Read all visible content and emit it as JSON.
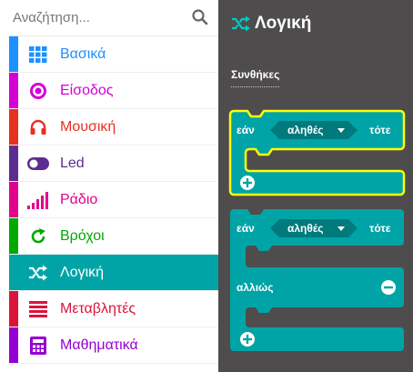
{
  "search": {
    "placeholder": "Αναζήτηση...",
    "icon": "search-icon"
  },
  "categories": [
    {
      "label": "Βασικά",
      "color": "#1e90ff",
      "icon": "grid-icon"
    },
    {
      "label": "Είσοδος",
      "color": "#d400d4",
      "icon": "input-circle-icon"
    },
    {
      "label": "Μουσική",
      "color": "#e63022",
      "icon": "headphones-icon"
    },
    {
      "label": "Led",
      "color": "#5c2d91",
      "icon": "toggle-icon"
    },
    {
      "label": "Ράδιο",
      "color": "#e3008c",
      "icon": "signal-bars-icon"
    },
    {
      "label": "Βρόχοι",
      "color": "#00aa00",
      "icon": "refresh-icon"
    },
    {
      "label": "Λογική",
      "color": "#00a4a6",
      "icon": "shuffle-icon",
      "selected": true
    },
    {
      "label": "Μεταβλητές",
      "color": "#dc143c",
      "icon": "list-icon"
    },
    {
      "label": "Μαθηματικά",
      "color": "#9400d3",
      "icon": "calculator-icon"
    }
  ],
  "flyout": {
    "title": "Λογική",
    "section": "Συνθήκες",
    "block_color": "#00a4a6",
    "block_dark": "#007a7c",
    "highlight_color": "#ffff00",
    "block1": {
      "if": "εάν",
      "condition": "αληθές",
      "then": "τότε"
    },
    "block2": {
      "if": "εάν",
      "condition": "αληθές",
      "then": "τότε",
      "else": "αλλιώς"
    }
  }
}
